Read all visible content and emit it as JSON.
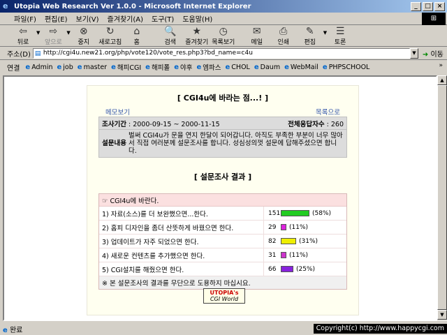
{
  "window": {
    "title": "Utopia Web Research Ver 1.0.0 - Microsoft Internet Explorer"
  },
  "menu": [
    "파일(F)",
    "편집(E)",
    "보기(V)",
    "즐겨찾기(A)",
    "도구(T)",
    "도움말(H)"
  ],
  "toolbar": {
    "back": "뒤로",
    "forward": "앞으로",
    "stop": "중지",
    "refresh": "새로고침",
    "home": "홈",
    "search": "검색",
    "favorites": "즐겨찾기",
    "history": "목록보기",
    "mail": "메일",
    "print": "인쇄",
    "edit": "편집",
    "discuss": "토론"
  },
  "address": {
    "label": "주소(D)",
    "url": "http://cgi4u.new21.org/php/vote120/vote_res.php3?bd_name=c4u",
    "go": "이동"
  },
  "links": {
    "label": "연결",
    "items": [
      "Admin",
      "job",
      "master",
      "해피CGI",
      "해피폴",
      "야후",
      "엠파스",
      "CHOL",
      "Daum",
      "WebMail",
      "PHPSCHOOL"
    ]
  },
  "page": {
    "title": "[ CGI4u에 바라는 점...! ]",
    "memo_link": "메모보기",
    "list_link": "목록으로",
    "period_label": "조사기간",
    "period_value": " : 2000-09-15 ~ 2000-11-15",
    "total_label": "전체응답자수",
    "total_value": " : 260",
    "desc_label": "설문내용",
    "desc_value": "벌써 CGI4u가 문을 연지 한달이 되어갑니다. 아직도 부족한 부분이 너무 많아서 직접 여러분께 설문조사를 합니다. 성심성의껏 설문에 답해주셨으면 합니다.",
    "result_title": "[ 설문조사 결과 ]",
    "question": "☞ CGI4u에 바란다.",
    "footer_note": "※ 본 설문조사의 결과를 무단으로 도용하지 마십시요.",
    "logo_line1": "UTOPIA's",
    "logo_line2": "CGI World"
  },
  "results": [
    {
      "label": "1) 자료(소스)를 더 보완했으면...한다.",
      "count": "151",
      "percent": "(58%)",
      "pct": 58,
      "color": "#22cc22"
    },
    {
      "label": "2) 홈피 디자인을 좀더 산뜻하게 바꿨으면 한다.",
      "count": "29",
      "percent": "(11%)",
      "pct": 11,
      "color": "#dd22dd"
    },
    {
      "label": "3) 업데이트가 자주 되었으면 한다.",
      "count": "82",
      "percent": "(31%)",
      "pct": 31,
      "color": "#eeee00"
    },
    {
      "label": "4) 새로운 컨텐츠를 추가했으면 한다.",
      "count": "31",
      "percent": "(11%)",
      "pct": 11,
      "color": "#cc33cc"
    },
    {
      "label": "5) CGI설치를 해줬으면 한다.",
      "count": "66",
      "percent": "(25%)",
      "pct": 25,
      "color": "#8822dd"
    }
  ],
  "status": {
    "text": "완료",
    "copyright": "Copyright(c) http://www.happycgi.com"
  }
}
